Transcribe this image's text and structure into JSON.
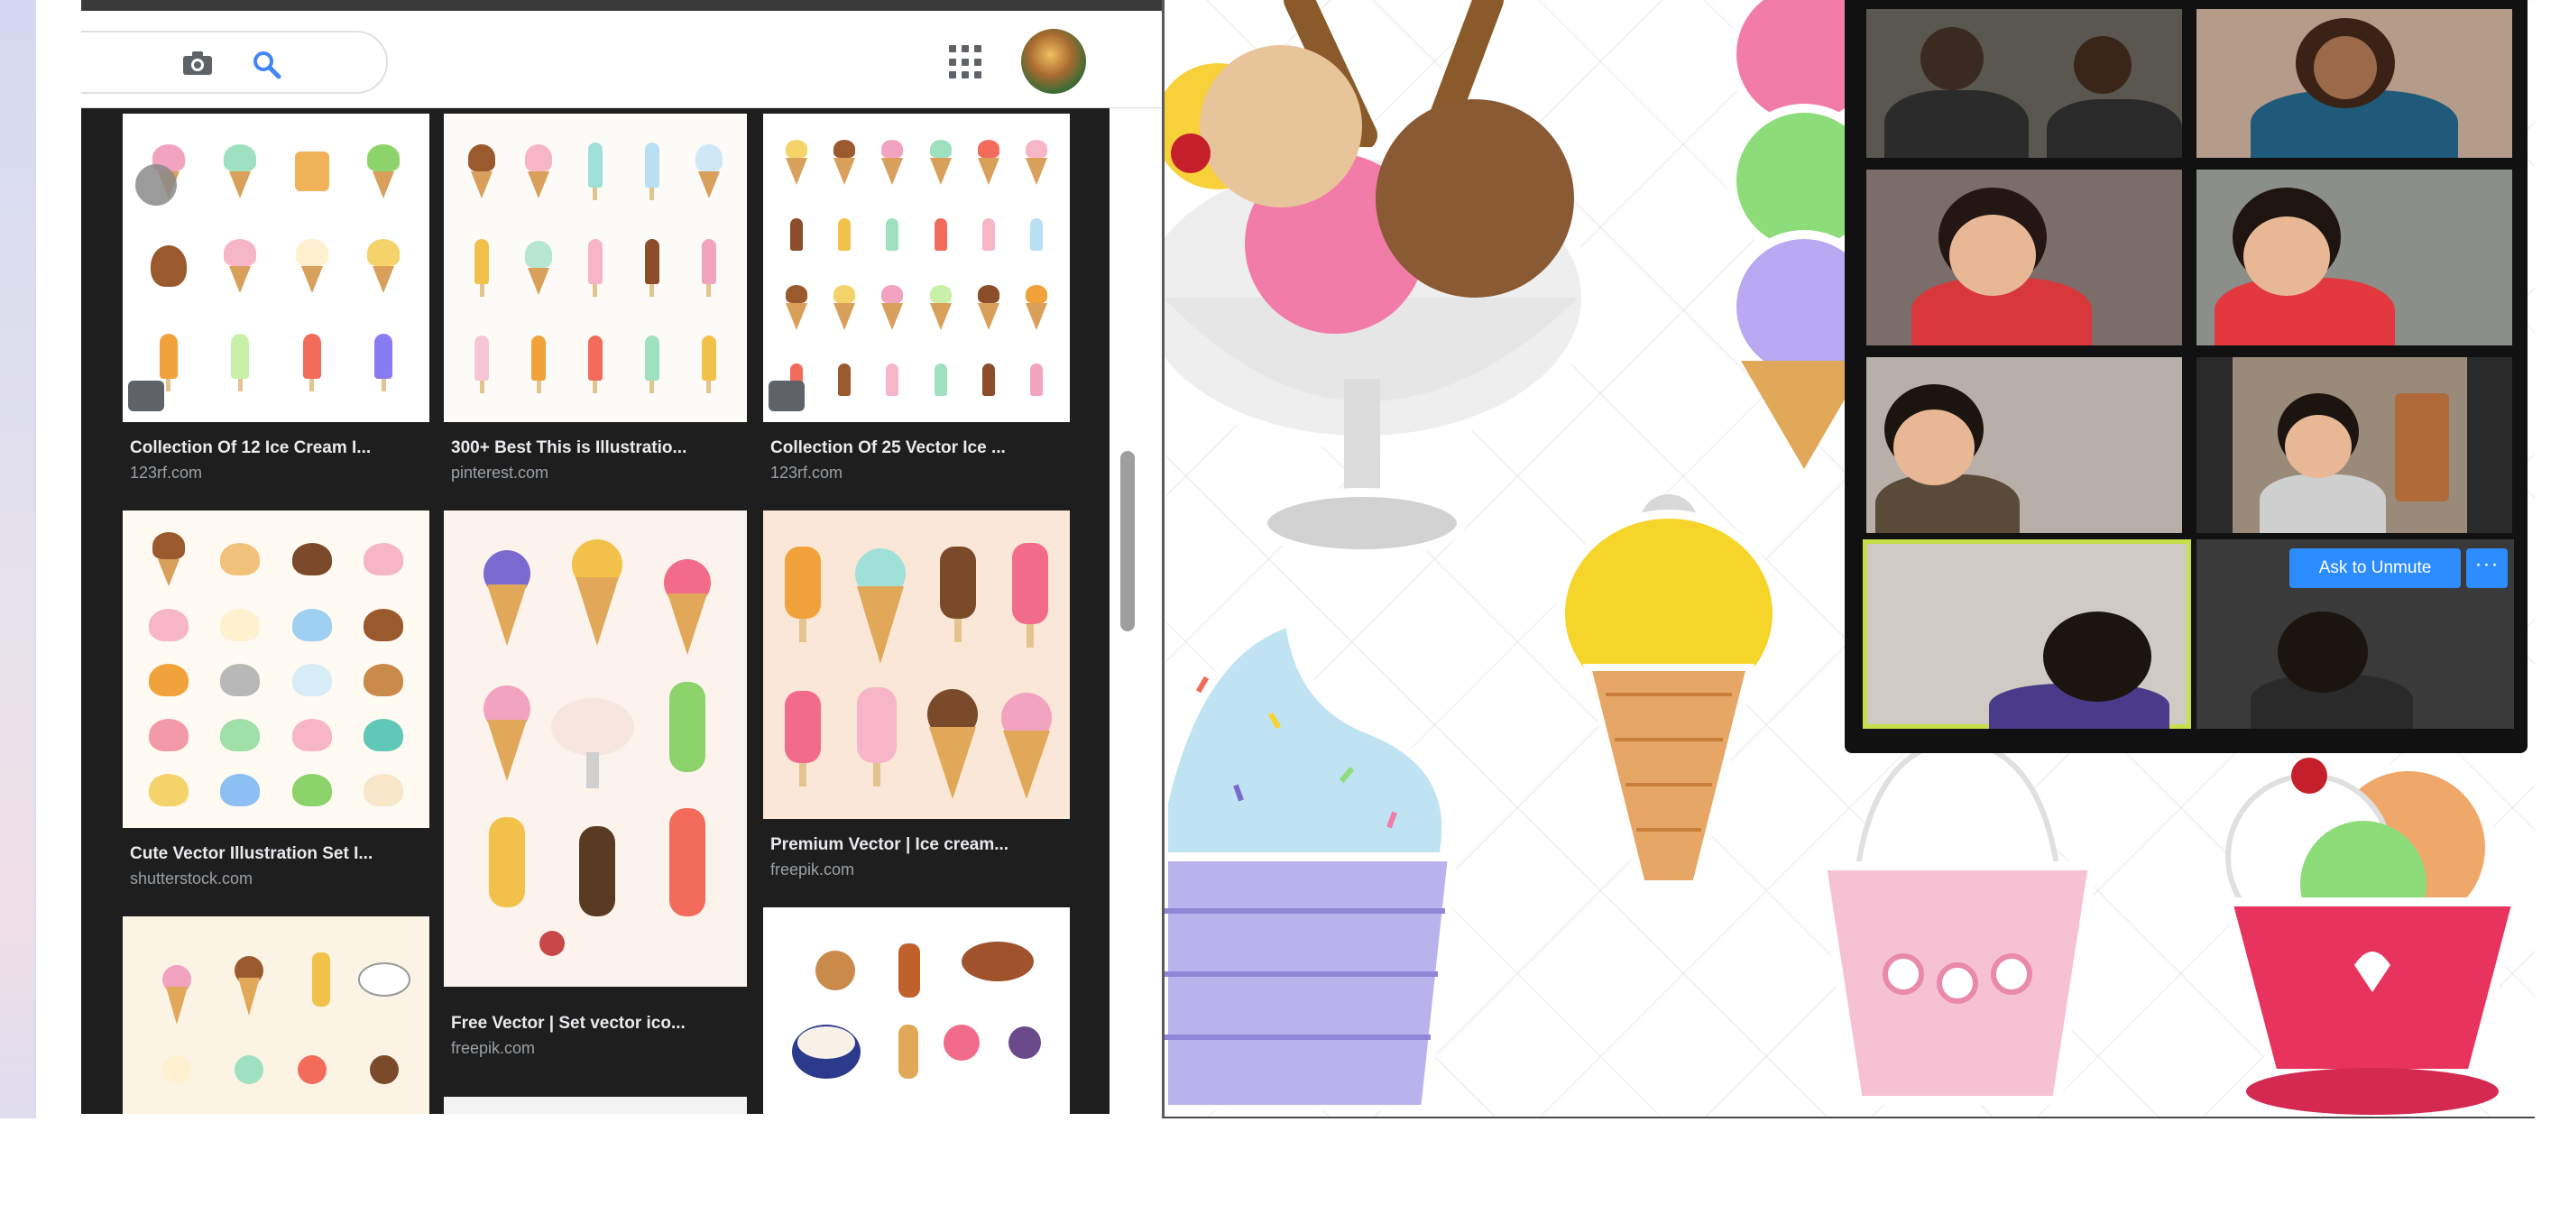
{
  "browser": {
    "header": {
      "camera_icon": "camera-icon",
      "search_icon": "search-icon",
      "apps_icon": "apps-grid-icon",
      "avatar": "account-avatar"
    },
    "results": [
      {
        "title": "Collection Of 12 Ice Cream I...",
        "source": "123rf.com"
      },
      {
        "title": "300+ Best This is Illustratio...",
        "source": "pinterest.com"
      },
      {
        "title": "Collection Of 25 Vector Ice ...",
        "source": "123rf.com"
      },
      {
        "title": "Cute Vector Illustration Set I...",
        "source": "shutterstock.com"
      },
      {
        "title": "Free Vector | Set vector ico...",
        "source": "freepik.com"
      },
      {
        "title": "Premium Vector | Ice cream...",
        "source": "freepik.com"
      }
    ]
  },
  "zoom": {
    "unmute_label": "Ask to Unmute",
    "more_label": "···"
  },
  "colors": {
    "zoom_highlight": "#c6e04a",
    "zoom_blue": "#2d8cff",
    "results_bg": "#1e1e1e"
  }
}
